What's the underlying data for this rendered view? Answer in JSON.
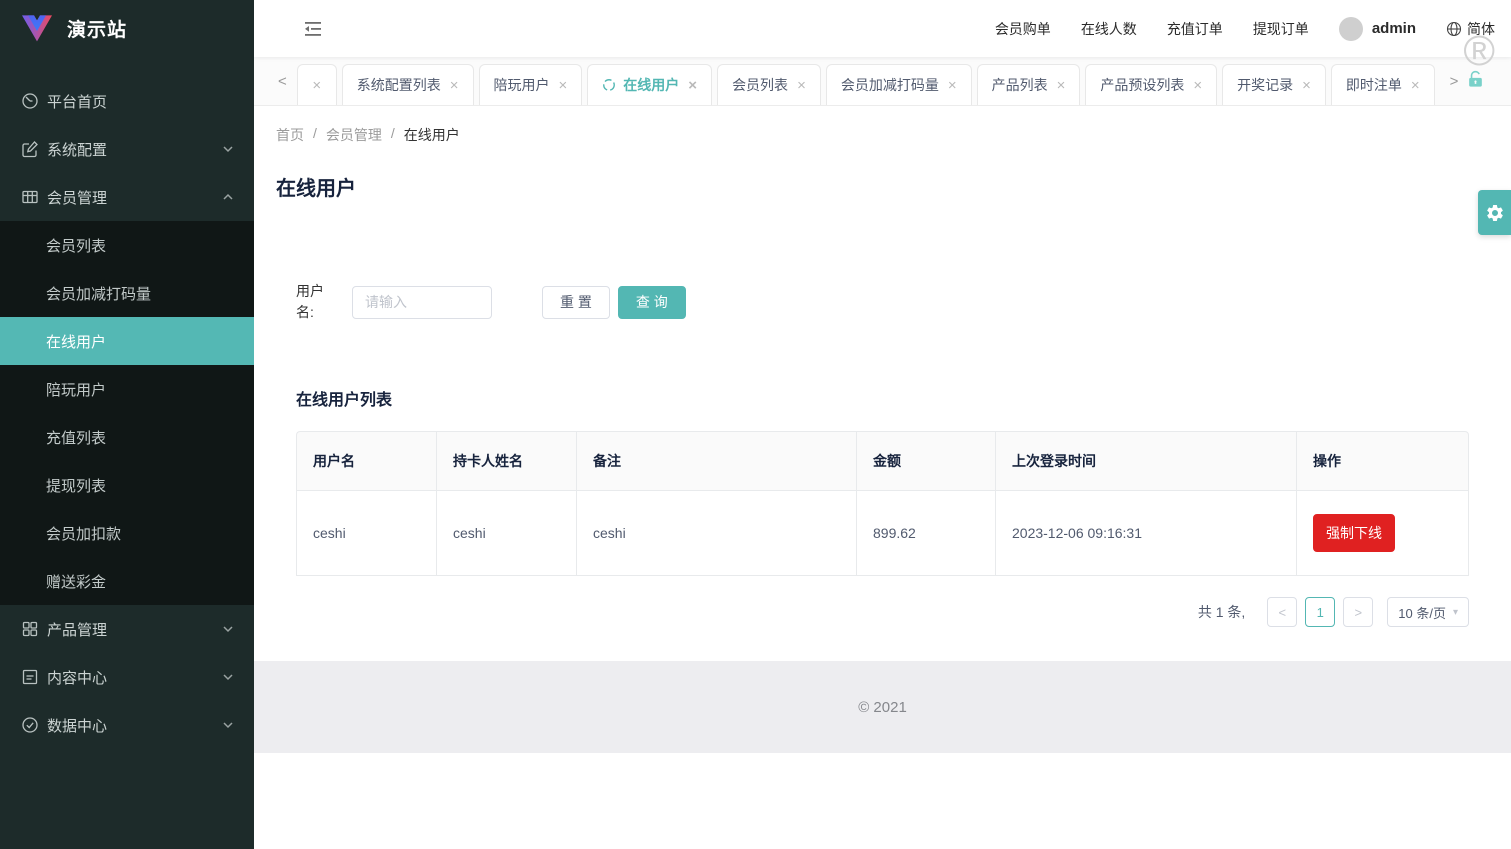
{
  "brand": {
    "title": "演示站"
  },
  "sidebar": {
    "home": "平台首页",
    "system": "系统配置",
    "members": "会员管理",
    "products": "产品管理",
    "content_center": "内容中心",
    "data_center": "数据中心",
    "submenu": [
      "会员列表",
      "会员加减打码量",
      "在线用户",
      "陪玩用户",
      "充值列表",
      "提现列表",
      "会员加扣款",
      "赠送彩金"
    ],
    "active_submenu": "在线用户"
  },
  "topbar": {
    "links": [
      "会员购单",
      "在线人数",
      "充值订单",
      "提现订单"
    ],
    "username": "admin",
    "language": "简体",
    "reg_mark": "®"
  },
  "tabs": {
    "items": [
      "系统配置列表",
      "陪玩用户",
      "在线用户",
      "会员列表",
      "会员加减打码量",
      "产品列表",
      "产品预设列表",
      "开奖记录",
      "即时注单"
    ],
    "active": "在线用户",
    "close_glyph": "×",
    "scroll_left": "<",
    "scroll_right": ">"
  },
  "breadcrumb": {
    "items": [
      "首页",
      "会员管理",
      "在线用户"
    ],
    "separator": "/"
  },
  "page": {
    "title": "在线用户"
  },
  "search_form": {
    "label": "用户名:",
    "placeholder": "请输入",
    "reset_label": "重 置",
    "query_label": "查 询"
  },
  "list": {
    "section_title": "在线用户列表",
    "columns": [
      "用户名",
      "持卡人姓名",
      "备注",
      "金额",
      "上次登录时间",
      "操作"
    ],
    "rows": [
      {
        "username": "ceshi",
        "cardholder": "ceshi",
        "remark": "ceshi",
        "amount": "899.62",
        "last_login": "2023-12-06 09:16:31",
        "action_label": "强制下线"
      }
    ]
  },
  "pagination": {
    "total_text": "共 1 条,",
    "prev": "<",
    "current_page": "1",
    "next": ">",
    "page_size": "10 条/页"
  },
  "footer": {
    "copyright": "© 2021"
  },
  "colors": {
    "accent": "#53b7b3",
    "danger": "#e02121",
    "sidebar_bg": "#1d2b2a",
    "submenu_bg": "#101716",
    "active_item_bg": "#54b8b4"
  }
}
